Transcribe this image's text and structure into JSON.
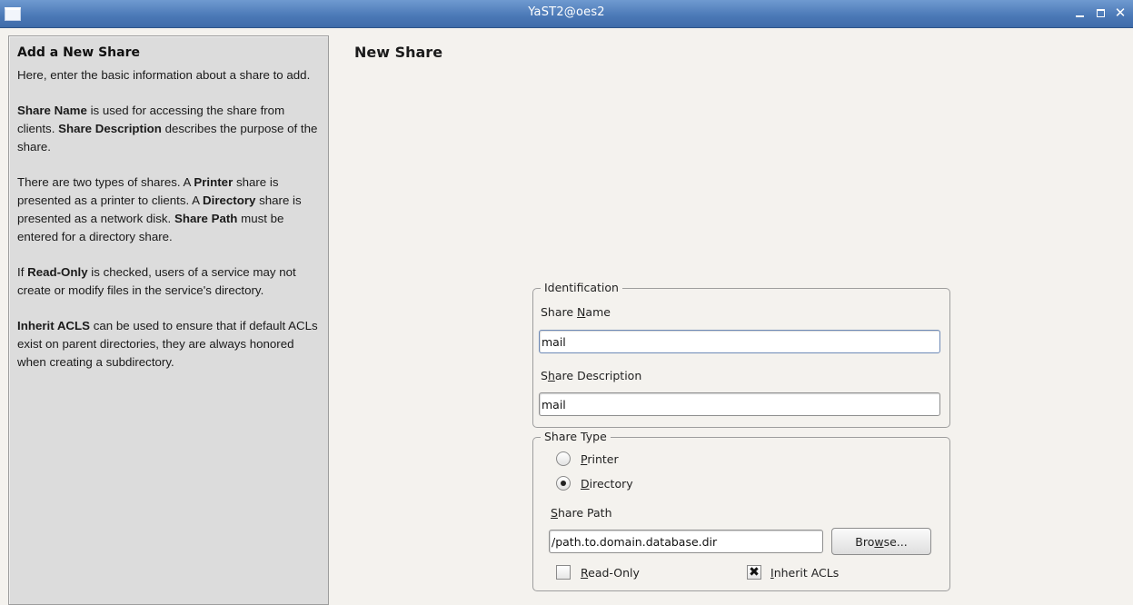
{
  "window": {
    "title": "YaST2@oes2",
    "minimize_icon": "minimize-icon",
    "maximize_icon": "maximize-icon",
    "close_glyph": "✕"
  },
  "help": {
    "title": "Add a New Share",
    "p1": "Here, enter the basic information about a share to add.",
    "p2_b1": "Share Name",
    "p2_t1": " is used for accessing the share from clients. ",
    "p2_b2": "Share Description",
    "p2_t2": " describes the purpose of the share.",
    "p3_t1": "There are two types of shares. A ",
    "p3_b1": "Printer",
    "p3_t2": " share is presented as a printer to clients. A ",
    "p3_b2": "Directory",
    "p3_t3": " share is presented as a network disk. ",
    "p3_b3": "Share Path",
    "p3_t4": " must be entered for a directory share.",
    "p4_t1": "If ",
    "p4_b1": "Read-Only",
    "p4_t2": " is checked, users of a service may not create or modify files in the service's directory.",
    "p5_b1": "Inherit ACLS",
    "p5_t1": " can be used to ensure that if default ACLs exist on parent directories, they are always honored when creating a subdirectory."
  },
  "main": {
    "heading": "New Share",
    "identification": {
      "legend": "Identification",
      "share_name_label_pre": "Share ",
      "share_name_label_u": "N",
      "share_name_label_post": "ame",
      "share_name_value": "mail",
      "share_desc_label_pre": "S",
      "share_desc_label_u": "h",
      "share_desc_label_post": "are Description",
      "share_desc_value": "mail"
    },
    "share_type": {
      "legend": "Share Type",
      "printer_u": "P",
      "printer_rest": "rinter",
      "printer_selected": false,
      "directory_u": "D",
      "directory_rest": "irectory",
      "directory_selected": true,
      "path_label_u": "S",
      "path_label_rest": "hare Path",
      "path_value": "/path.to.domain.database.dir",
      "browse_pre": "Bro",
      "browse_u": "w",
      "browse_post": "se...",
      "readonly_u": "R",
      "readonly_rest": "ead-Only",
      "readonly_checked": false,
      "inherit_u": "I",
      "inherit_rest": "nherit ACLs",
      "inherit_checked": true,
      "check_glyph": "✖"
    }
  }
}
